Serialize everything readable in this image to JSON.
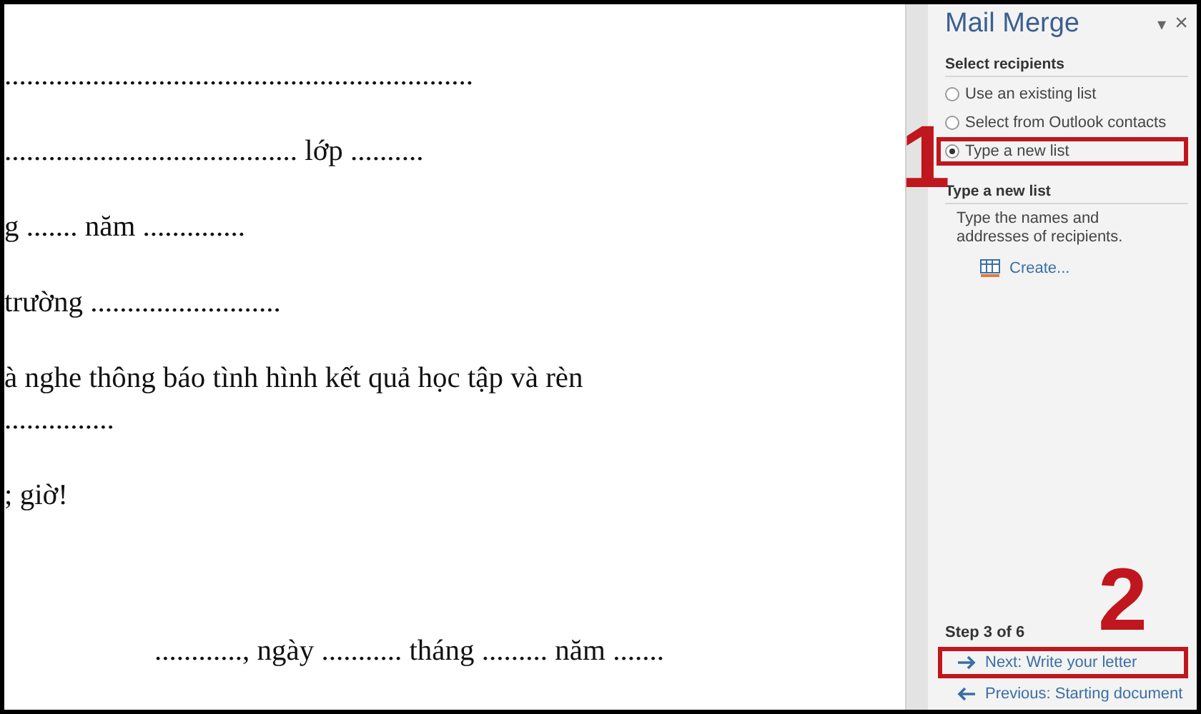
{
  "document": {
    "paragraphs": [
      {
        "kind": "line",
        "lines": [
          "................................................................"
        ]
      },
      {
        "kind": "line",
        "lines": [
          "........................................ lớp .........."
        ]
      },
      {
        "kind": "line",
        "lines": [
          "g ....... năm .............."
        ]
      },
      {
        "kind": "line",
        "lines": [
          "trường .........................."
        ]
      },
      {
        "kind": "line",
        "lines": [
          "à nghe thông báo tình hình kết quả học tập và rèn",
          "..............."
        ]
      },
      {
        "kind": "line",
        "lines": [
          "; giờ!"
        ]
      },
      {
        "kind": "date",
        "lines": [
          "............, ngày ........... tháng ......... năm ......."
        ]
      }
    ]
  },
  "pane": {
    "title": "Mail Merge",
    "menu_glyph": "▾",
    "close_glyph": "×",
    "section": "Select recipients",
    "options": [
      {
        "label": "Use an existing list",
        "selected": false,
        "highlighted": false
      },
      {
        "label": "Select from Outlook contacts",
        "selected": false,
        "highlighted": false
      },
      {
        "label": "Type a new list",
        "selected": true,
        "highlighted": true
      }
    ],
    "subsection": "Type a new list",
    "description": "Type the names and addresses of recipients.",
    "create_link": "Create...",
    "step": "Step 3 of 6",
    "nav": [
      {
        "kind": "next",
        "label": "Next: Write your letter",
        "highlighted": true
      },
      {
        "kind": "previous",
        "label": "Previous: Starting document",
        "highlighted": false
      }
    ]
  },
  "annotations": [
    {
      "label": "1"
    },
    {
      "label": "2"
    }
  ]
}
